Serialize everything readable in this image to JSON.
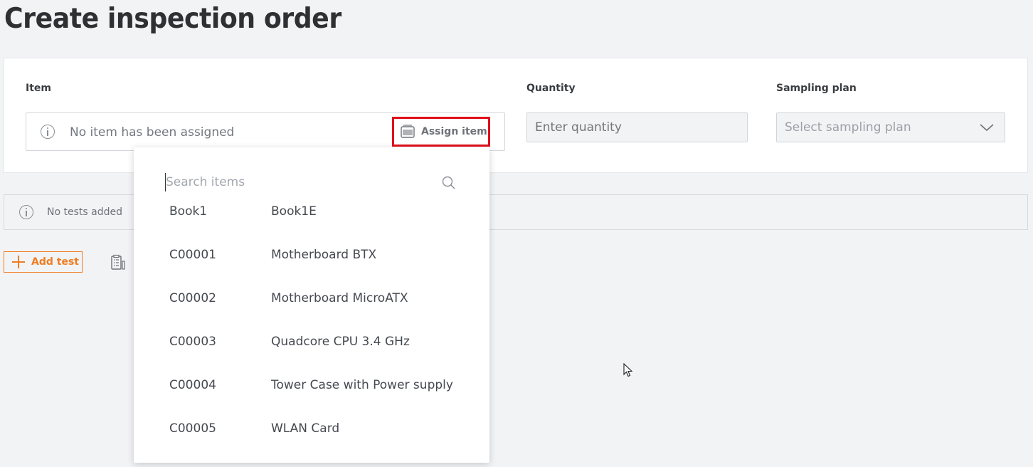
{
  "page": {
    "title": "Create inspection order"
  },
  "form": {
    "item": {
      "label": "Item",
      "empty_text": "No item has been assigned",
      "assign_label": "Assign item"
    },
    "quantity": {
      "label": "Quantity",
      "placeholder": "Enter quantity"
    },
    "sampling_plan": {
      "label": "Sampling plan",
      "placeholder": "Select sampling plan"
    }
  },
  "tests": {
    "empty_text": "No tests added",
    "add_label": "Add test"
  },
  "dropdown": {
    "search_placeholder": "Search items",
    "items": [
      {
        "code": "Book1",
        "name": "Book1E"
      },
      {
        "code": "C00001",
        "name": "Motherboard BTX"
      },
      {
        "code": "C00002",
        "name": "Motherboard MicroATX"
      },
      {
        "code": "C00003",
        "name": "Quadcore CPU 3.4 GHz"
      },
      {
        "code": "C00004",
        "name": "Tower Case with Power supply"
      },
      {
        "code": "C00005",
        "name": "WLAN Card"
      }
    ]
  },
  "colors": {
    "accent": "#ef7d22",
    "highlight": "#e0101a",
    "background": "#f2f3f5"
  },
  "icons": [
    "info-icon",
    "barcode-icon",
    "chevron-down-icon",
    "plus-icon",
    "checklist-icon",
    "search-icon",
    "cursor-icon"
  ]
}
